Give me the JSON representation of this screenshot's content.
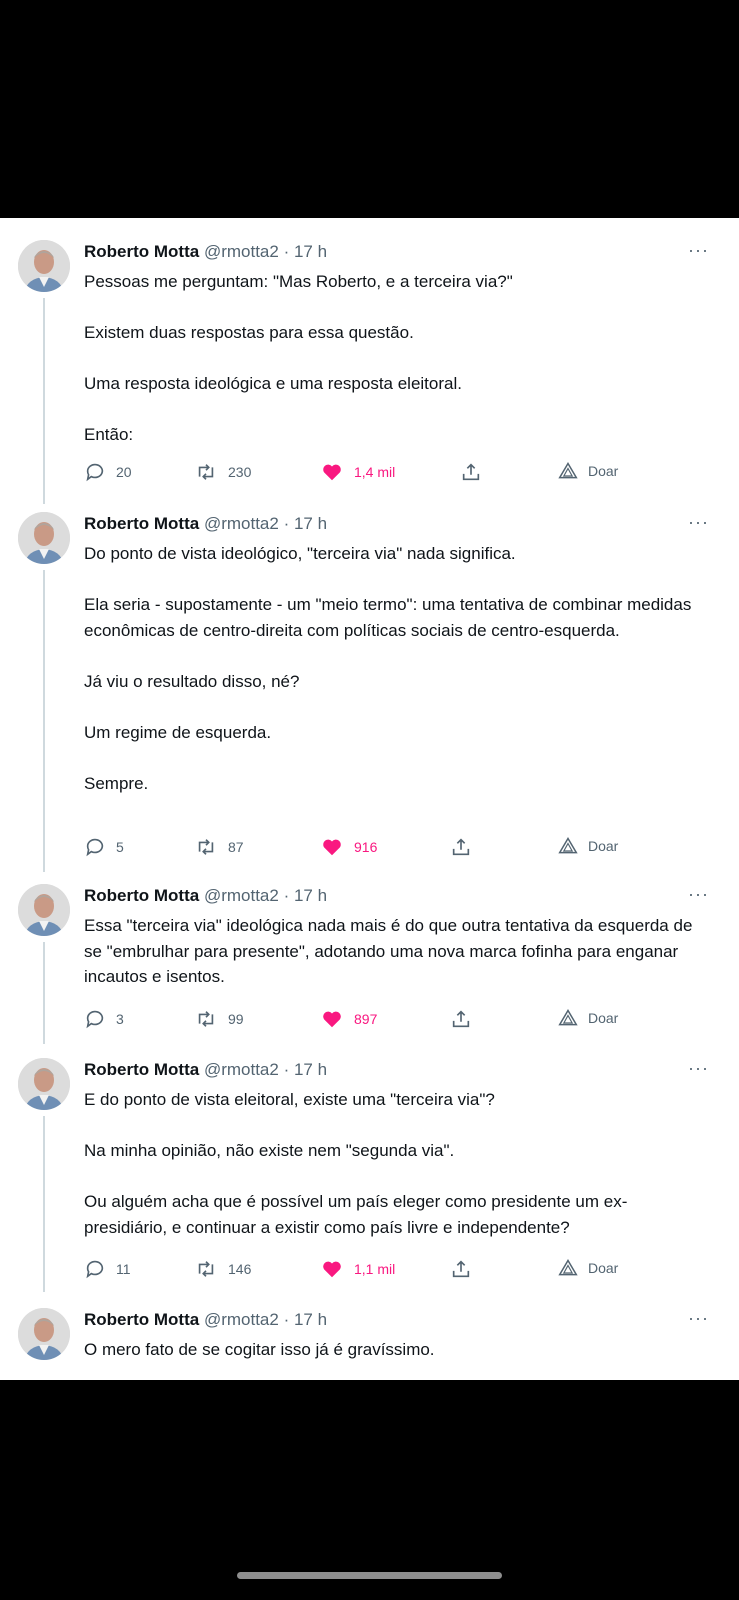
{
  "author": {
    "name": "Roberto Motta",
    "handle": "@rmotta2",
    "time": "· 17 h"
  },
  "more_label": "···",
  "tweets": [
    {
      "paragraphs": [
        "Pessoas me perguntam: \"Mas Roberto, e a terceira via?\"",
        "Existem duas respostas para essa questão.",
        "Uma resposta ideológica e uma resposta eleitoral.",
        "Então:"
      ],
      "replies": "20",
      "retweets": "230",
      "likes": "1,4 mil",
      "donate": "Doar"
    },
    {
      "paragraphs": [
        "Do ponto de vista ideológico, \"terceira via\" nada significa.",
        "Ela seria - supostamente - um \"meio termo\": uma tentativa de combinar medidas econômicas de centro-direita com políticas sociais de centro-esquerda.",
        "Já viu o resultado disso, né?",
        "Um regime de esquerda.",
        "Sempre."
      ],
      "replies": "5",
      "retweets": "87",
      "likes": "916",
      "donate": "Doar"
    },
    {
      "paragraphs": [
        "Essa \"terceira via\" ideológica nada mais é do que outra tentativa da esquerda de se \"embrulhar para presente\", adotando uma nova marca fofinha para enganar incautos e isentos."
      ],
      "replies": "3",
      "retweets": "99",
      "likes": "897",
      "donate": "Doar"
    },
    {
      "paragraphs": [
        "E do ponto de vista eleitoral, existe uma \"terceira via\"?",
        "Na minha opinião, não existe nem \"segunda via\".",
        "Ou alguém acha que é possível um país eleger como presidente um ex-presidiário, e continuar a existir como país livre e independente?"
      ],
      "replies": "11",
      "retweets": "146",
      "likes": "1,1 mil",
      "donate": "Doar"
    },
    {
      "paragraphs": [
        "O mero fato de se cogitar isso já é gravíssimo."
      ]
    }
  ],
  "colors": {
    "like": "#f91880",
    "muted": "#536471",
    "text": "#0f1419",
    "thread_line": "#cfd9de"
  }
}
